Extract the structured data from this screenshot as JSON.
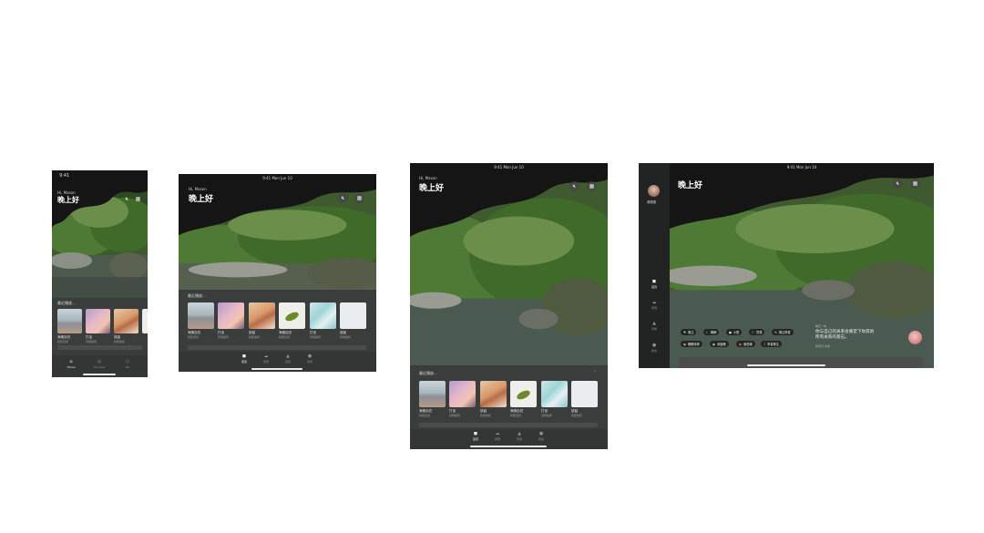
{
  "greeting": "晚上好",
  "greeting_sub": "Hi, Mason",
  "status_time_phone": "9:41",
  "status_time_tablet": "9:41  Mon Jun 10",
  "recent_title": "最近播放...",
  "recent_more": "›",
  "sound_icon": "sound-off-icon",
  "grid_icon": "grid-icon",
  "recent_items": [
    {
      "title": "海風自在",
      "sub": "聆聽自然"
    },
    {
      "title": "打坐",
      "sub": "冥想練習"
    },
    {
      "title": "放鬆",
      "sub": "聆聽放鬆"
    },
    {
      "title": "海風自在",
      "sub": "聆聽自然"
    },
    {
      "title": "打坐",
      "sub": "冥想練習"
    },
    {
      "title": "放鬆",
      "sub": "聆聽放鬆"
    }
  ],
  "phone_tabs": [
    {
      "label": "Home",
      "icon": "home-icon"
    },
    {
      "label": "Discover",
      "icon": "compass-icon"
    },
    {
      "label": "Me",
      "icon": "user-icon"
    }
  ],
  "tablet_tabs": [
    {
      "label": "首頁",
      "icon": "home-icon"
    },
    {
      "label": "發現",
      "icon": "cloud-icon"
    },
    {
      "label": "冥想",
      "icon": "mountain-icon"
    },
    {
      "label": "我的",
      "icon": "user-icon"
    }
  ],
  "sidebar": {
    "user_name": "黃曉燕",
    "items": [
      {
        "label": "首頁",
        "icon": "home-icon"
      },
      {
        "label": "發現",
        "icon": "cloud-icon"
      },
      {
        "label": "冥想",
        "icon": "mountain-icon"
      },
      {
        "label": "我的",
        "icon": "user-icon"
      }
    ]
  },
  "chips": [
    {
      "label": "專注",
      "icon": "⚑"
    },
    {
      "label": "睡眠",
      "icon": "☾"
    },
    {
      "label": "小憩",
      "icon": "◼"
    },
    {
      "label": "冥想",
      "icon": "⚐"
    },
    {
      "label": "專注學習",
      "icon": "✎"
    },
    {
      "label": "睡眠時神",
      "icon": "●"
    },
    {
      "label": "深度睡",
      "icon": "●"
    },
    {
      "label": "番茄鐘",
      "icon": "●"
    },
    {
      "label": "學習專注",
      "icon": "♪"
    }
  ],
  "quote": {
    "tag": "每日一句",
    "text": "你与自己的关系会奠定下你其他所有关系的基石。",
    "author": "斯蒂芬·柯维"
  },
  "colors": {
    "background": "#ffffff",
    "sheet": "#3a3d3b",
    "tabbar": "#333634",
    "sidebar": "#222423",
    "accent_text": "#f0f0f0"
  }
}
